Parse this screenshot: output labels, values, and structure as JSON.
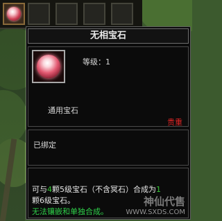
{
  "tooltip": {
    "title": "无相宝石",
    "level_label": "等级：1",
    "type_label": "通用宝石",
    "rarity_label": "贵重",
    "bind_status": "已绑定",
    "description": {
      "line1_a": "可与",
      "line1_n1": "4",
      "line1_b": "颗5级宝石（不含冥石）合成为",
      "line1_n2": "1",
      "line2": "颗6级宝石。",
      "line3": "无法镶嵌和单独合成。"
    }
  },
  "watermark": {
    "text_cn": "神仙代售",
    "url": "WWW.SXDS.COM"
  },
  "colors": {
    "rarity": "#e02525",
    "number_highlight": "#35c635",
    "note_green": "#2fd04a"
  },
  "icons": [
    "gem-icon",
    "gem-item-icon"
  ]
}
